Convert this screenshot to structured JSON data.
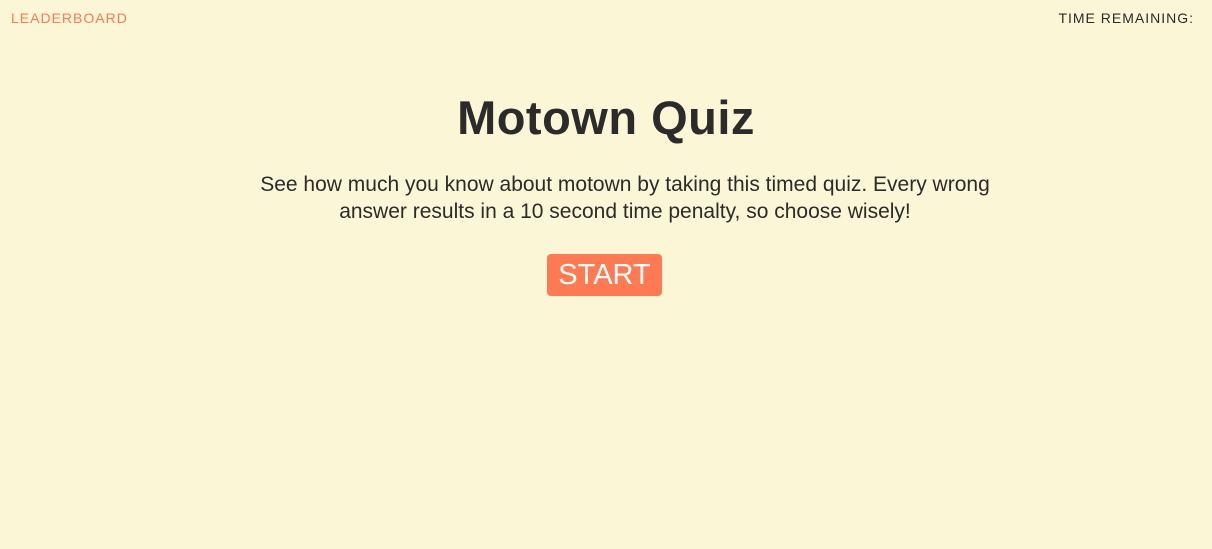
{
  "header": {
    "leaderboard_label": "LEADERBOARD",
    "time_remaining_label": "TIME REMAINING:",
    "time_remaining_value": ""
  },
  "main": {
    "title": "Motown Quiz",
    "description": "See how much you know about motown by taking this timed quiz. Every wrong answer results in a 10 second time penalty, so choose wisely!",
    "start_label": "START"
  },
  "colors": {
    "background": "#fbf7d6",
    "accent": "#ff7a52",
    "text": "#2b2b2b"
  }
}
